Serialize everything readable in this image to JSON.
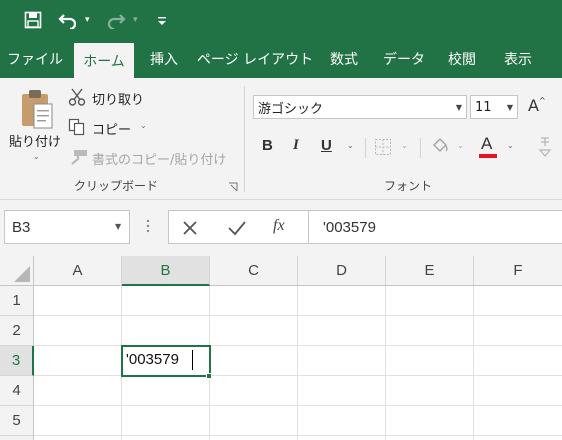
{
  "colors": {
    "brand": "#217346",
    "font_color_bar": "#e81123"
  },
  "qat": {
    "save_icon": "save-icon",
    "undo_icon": "undo-icon",
    "redo_icon": "redo-icon",
    "customize_icon": "customize-qat-icon"
  },
  "tabs": [
    {
      "label": "ファイル"
    },
    {
      "label": "ホーム",
      "active": true
    },
    {
      "label": "挿入"
    },
    {
      "label": "ページ レイアウト"
    },
    {
      "label": "数式"
    },
    {
      "label": "データ"
    },
    {
      "label": "校閲"
    },
    {
      "label": "表示"
    }
  ],
  "clipboard": {
    "paste_label": "貼り付け",
    "cut_label": "切り取り",
    "copy_label": "コピー",
    "format_painter_label": "書式のコピー/貼り付け",
    "group_label": "クリップボード"
  },
  "font": {
    "name": "游ゴシック",
    "size": "11",
    "bold": "B",
    "italic": "I",
    "underline": "U",
    "font_color_letter": "A",
    "group_label": "フォント",
    "grow_label": "A"
  },
  "formula_bar": {
    "name_box": "B3",
    "fx_label": "fx",
    "content": "'003579"
  },
  "sheet": {
    "columns": [
      "A",
      "B",
      "C",
      "D",
      "E",
      "F"
    ],
    "rows": [
      "1",
      "2",
      "3",
      "4",
      "5"
    ],
    "selected_column": "B",
    "selected_row": "3",
    "active_cell_value": "'003579"
  }
}
